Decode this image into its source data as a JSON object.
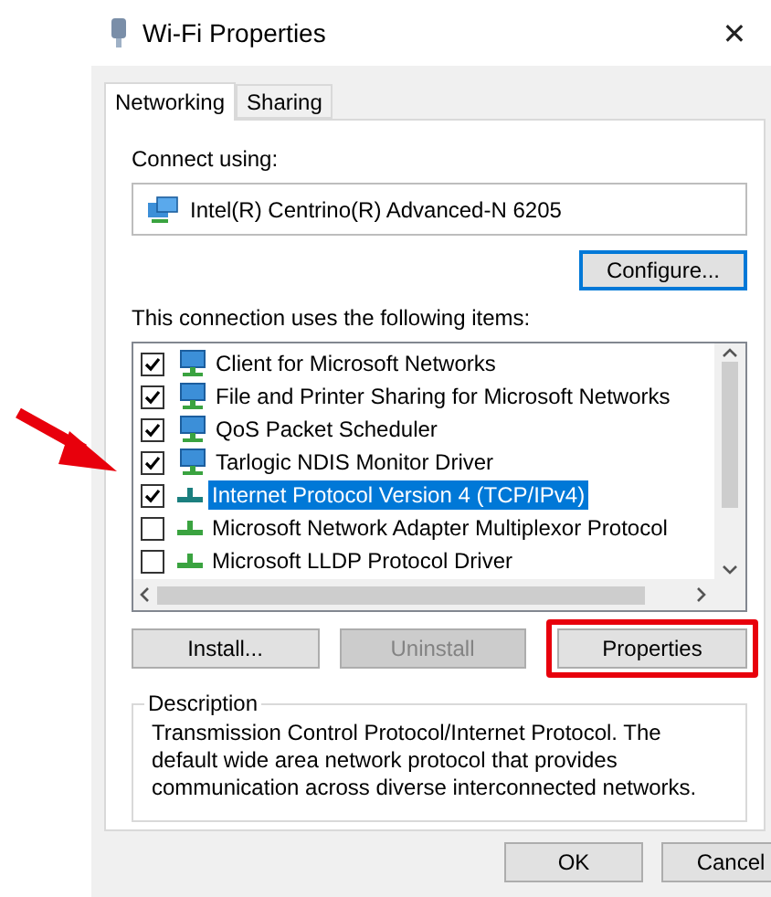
{
  "window": {
    "title": "Wi-Fi Properties",
    "close": "✕"
  },
  "tabs": [
    {
      "label": "Networking",
      "selected": true
    },
    {
      "label": "Sharing",
      "selected": false
    }
  ],
  "connect_using": {
    "label": "Connect using:",
    "adapter": "Intel(R) Centrino(R) Advanced-N 6205",
    "button": "Configure..."
  },
  "items_label": "This connection uses the following items:",
  "items": [
    {
      "name": "Client for Microsoft Networks",
      "kind": "service",
      "checked": true,
      "selected": false
    },
    {
      "name": "File and Printer Sharing for Microsoft Networks",
      "kind": "service",
      "checked": true,
      "selected": false
    },
    {
      "name": "QoS Packet Scheduler",
      "kind": "service",
      "checked": true,
      "selected": false
    },
    {
      "name": "Tarlogic NDIS Monitor Driver",
      "kind": "service",
      "checked": true,
      "selected": false
    },
    {
      "name": "Internet Protocol Version 4 (TCP/IPv4)",
      "kind": "protocol",
      "checked": true,
      "selected": true
    },
    {
      "name": "Microsoft Network Adapter Multiplexor Protocol",
      "kind": "protocol",
      "checked": false,
      "selected": false
    },
    {
      "name": "Microsoft LLDP Protocol Driver",
      "kind": "protocol",
      "checked": false,
      "selected": false
    }
  ],
  "item_buttons": [
    {
      "label": "Install...",
      "disabled": false,
      "highlighted": false
    },
    {
      "label": "Uninstall",
      "disabled": true,
      "highlighted": false
    },
    {
      "label": "Properties",
      "disabled": false,
      "highlighted": true
    }
  ],
  "description": {
    "title": "Description",
    "text": "Transmission Control Protocol/Internet Protocol. The default wide area network protocol that provides communication across diverse interconnected networks."
  },
  "dialog_buttons": [
    "OK",
    "Cancel"
  ]
}
